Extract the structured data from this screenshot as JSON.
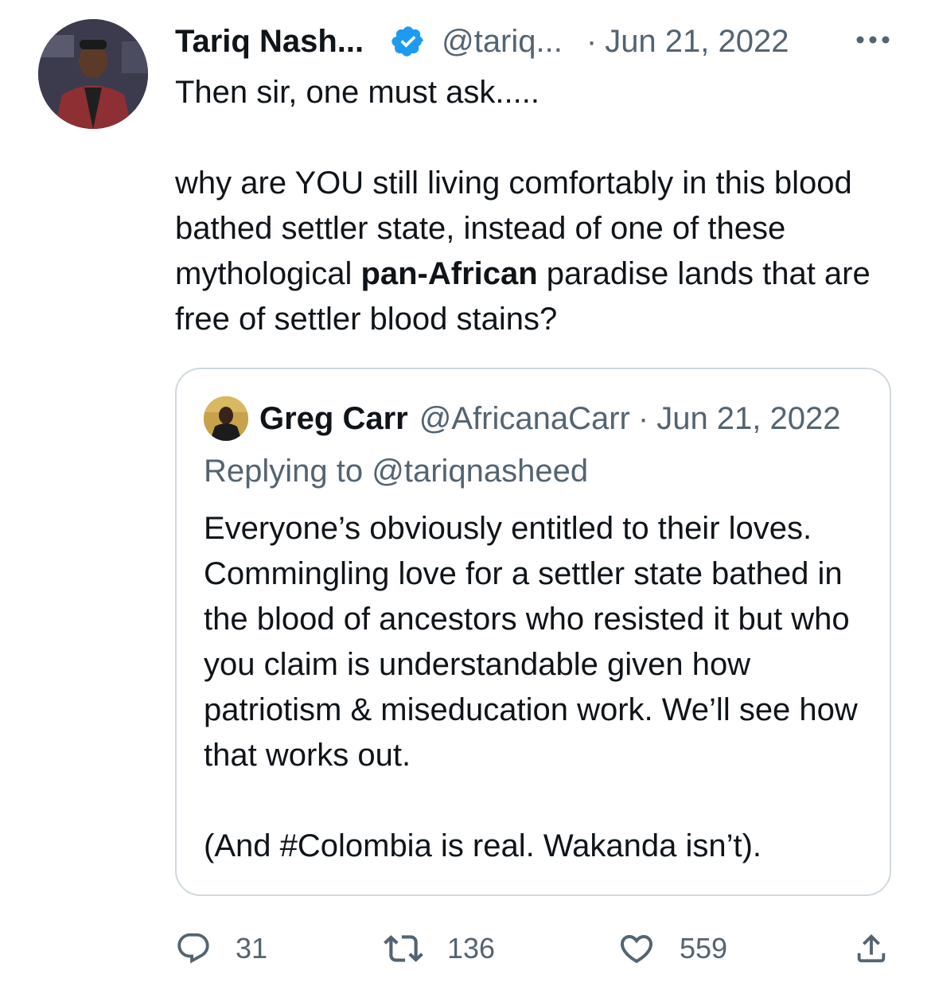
{
  "tweet": {
    "author_name": "Tariq Nash...",
    "author_handle": "@tariq...",
    "separator": "·",
    "date": "Jun 21, 2022",
    "text_line1": "Then sir, one must ask.....",
    "text_p2_before": "why are YOU still living comfortably in this blood bathed settler state, instead of one of these mythological ",
    "text_p2_bold": "pan-African",
    "text_p2_after": " paradise lands that are free of settler blood stains?"
  },
  "quoted": {
    "author_name": "Greg Carr",
    "author_handle": "@AfricanaCarr",
    "separator": "·",
    "date": "Jun 21, 2022",
    "replying_to": "Replying to @tariqnasheed",
    "text_p1": "Everyone’s obviously entitled to their loves. Commingling love for a settler state bathed in the blood of ancestors who resisted it but who you claim is understandable given how patriotism & miseducation work. We’ll see how that works out.",
    "text_p2": "(And #Colombia is real. Wakanda isn’t)."
  },
  "actions": {
    "replies": "31",
    "retweets": "136",
    "likes": "559"
  },
  "icons": {
    "verified": "verified-badge-icon",
    "more": "more-options-icon",
    "reply": "reply-icon",
    "retweet": "retweet-icon",
    "like": "heart-icon",
    "share": "share-icon"
  },
  "colors": {
    "verified_blue": "#1d9bf0",
    "secondary_text": "#536471",
    "border": "#cfd9de"
  }
}
